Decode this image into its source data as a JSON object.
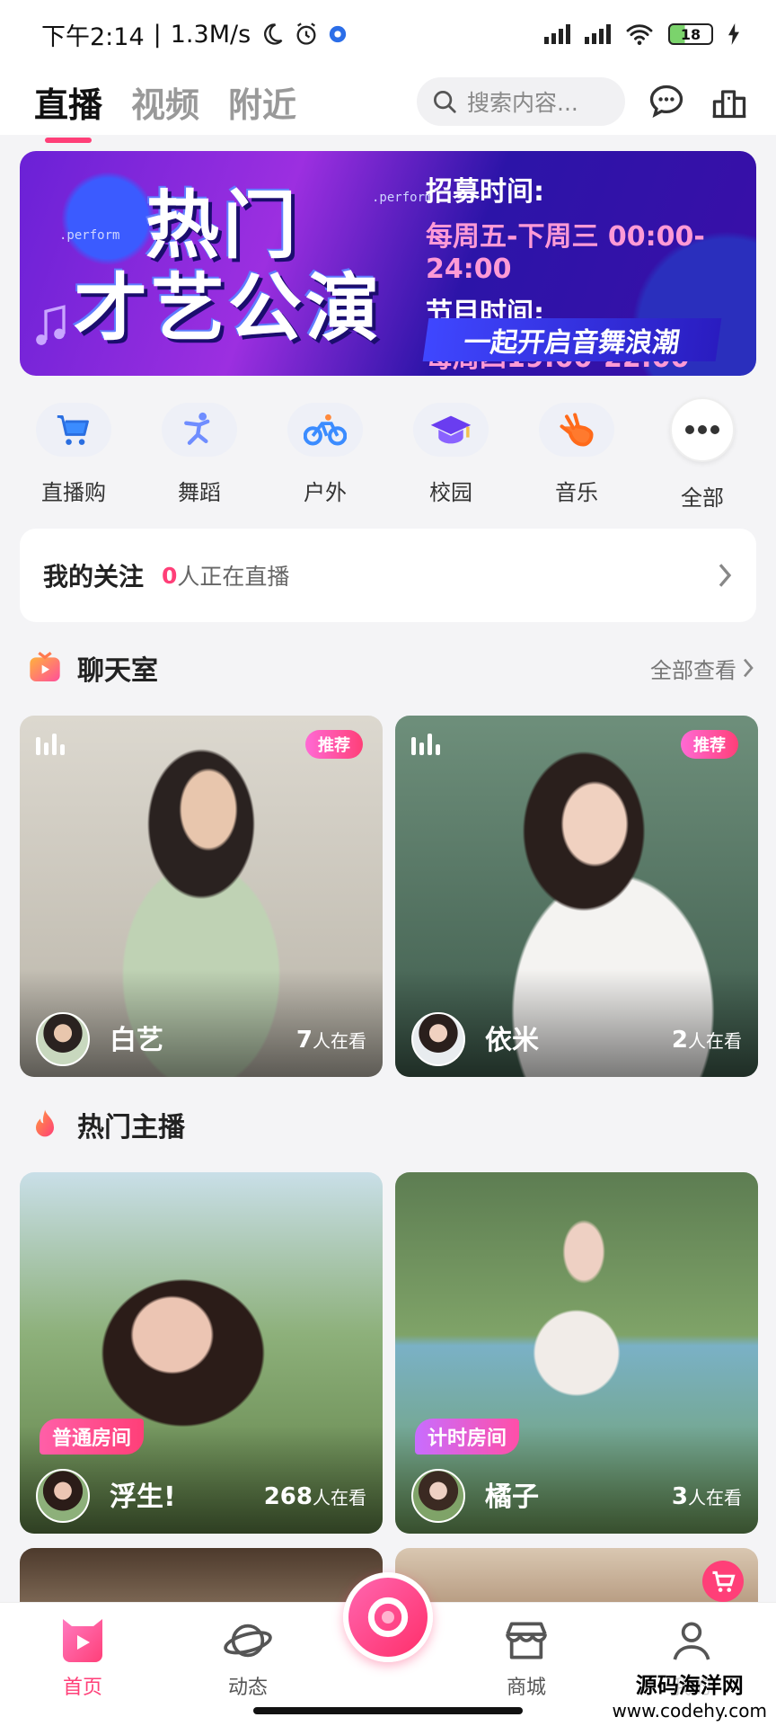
{
  "status_bar": {
    "time": "下午2:14",
    "speed": "1.3M/s",
    "battery": "18"
  },
  "top_nav": {
    "tabs": [
      {
        "label": "直播",
        "active": true
      },
      {
        "label": "视频",
        "active": false
      },
      {
        "label": "附近",
        "active": false
      }
    ],
    "search_placeholder": "搜索内容..."
  },
  "banner": {
    "perform_tag": ".perform",
    "title_line1": "热门",
    "title_line2": "才艺公演",
    "recruit_label": "招募时间:",
    "recruit_value": "每周五-下周三 00:00-24:00",
    "show_label": "节目时间:",
    "show_value": "每周四19:00-22:00",
    "slogan": "一起开启音舞浪潮"
  },
  "categories": [
    {
      "label": "直播购",
      "icon": "cart-icon"
    },
    {
      "label": "舞蹈",
      "icon": "dancer-icon"
    },
    {
      "label": "户外",
      "icon": "bicycle-icon"
    },
    {
      "label": "校园",
      "icon": "graduation-cap-icon"
    },
    {
      "label": "音乐",
      "icon": "hand-icon"
    },
    {
      "label": "全部",
      "icon": "more-dots-icon"
    }
  ],
  "follow": {
    "title": "我的关注",
    "count": "0",
    "suffix": "人正在直播"
  },
  "chat_section": {
    "title": "聊天室",
    "more": "全部查看"
  },
  "chat_rooms": [
    {
      "name": "白艺",
      "count": "7",
      "unit": "人在看",
      "badge": "推荐"
    },
    {
      "name": "依米",
      "count": "2",
      "unit": "人在看",
      "badge": "推荐"
    }
  ],
  "hot_section": {
    "title": "热门主播"
  },
  "hot_anchors": [
    {
      "name": "浮生!",
      "count": "268",
      "unit": "人在看",
      "room_type": "普通房间"
    },
    {
      "name": "橘子",
      "count": "3",
      "unit": "人在看",
      "room_type": "计时房间"
    }
  ],
  "bottom_nav": [
    {
      "label": "首页",
      "active": true
    },
    {
      "label": "动态",
      "active": false
    },
    {
      "label": "商城",
      "active": false
    },
    {
      "label": "我的",
      "active": false
    }
  ],
  "watermark": {
    "title": "源码海洋网",
    "url": "www.codehy.com"
  },
  "colors": {
    "accent": "#ff3f78",
    "background": "#f4f4f6"
  }
}
